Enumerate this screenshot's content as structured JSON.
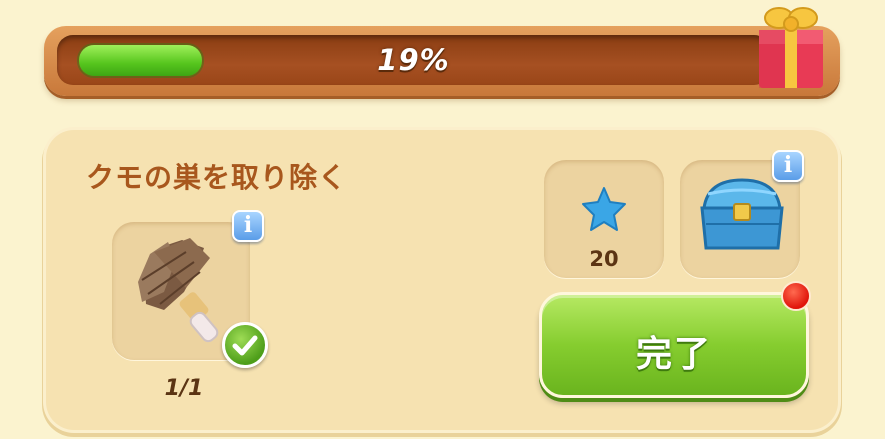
{
  "progress": {
    "label": "19%",
    "value": 0.19
  },
  "task": {
    "title": "クモの巣を取り除く",
    "item": {
      "icon": "feather-duster-icon",
      "count_label": "1/1",
      "completed": true
    },
    "rewards": [
      {
        "icon": "blue-star-icon",
        "count_label": "20"
      },
      {
        "icon": "blue-treasure-chest-icon"
      }
    ],
    "complete_button_label": "完了",
    "info_label": "i"
  },
  "colors": {
    "progress_fill": "#56c51d",
    "title_text": "#a8571d",
    "complete_button": "#86cd2f",
    "notification_dot": "#e0140a",
    "info_button": "#5a9de8"
  }
}
